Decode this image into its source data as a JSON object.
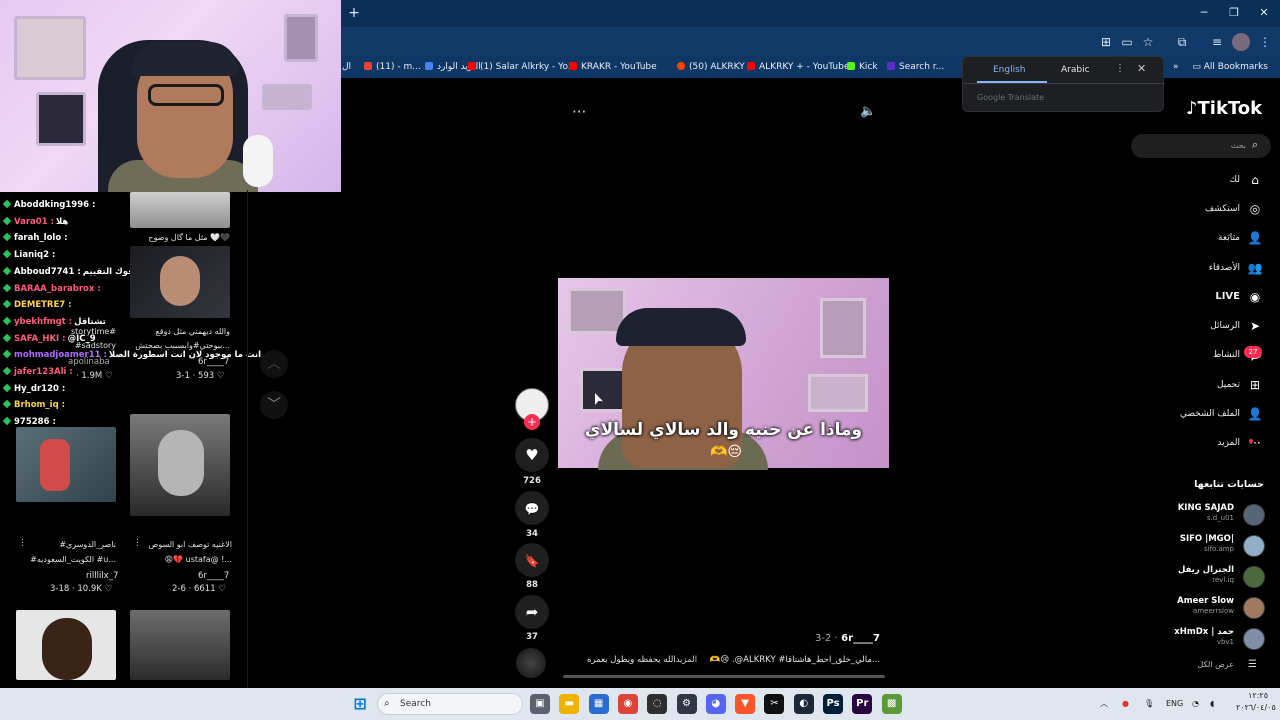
{
  "browser": {
    "new_tab_label": "+",
    "window_controls": {
      "minimize": "─",
      "restore": "❐",
      "close": "✕"
    },
    "bookmarks": [
      {
        "label": "ال",
        "color": "#888888"
      },
      {
        "label": "(11) - m...",
        "color": "#ea4335"
      },
      {
        "label": "البريد الوارد",
        "color": "#4285f4"
      },
      {
        "label": "(1) Salar Alkrky - Yo...",
        "color": "#ff0000"
      },
      {
        "label": "KRAKR - YouTube",
        "color": "#ff0000"
      },
      {
        "label": "(50) ALKRKY",
        "color": "#ff4500"
      },
      {
        "label": "ALKRKY + - YouTube",
        "color": "#ff0000"
      },
      {
        "label": "Kick",
        "color": "#53fc18"
      },
      {
        "label": "Search r...",
        "color": "#5b2ec7"
      },
      {
        "label": "رافت -",
        "color": "#777777"
      }
    ],
    "all_bookmarks_label": "All Bookmarks",
    "more_bookmarks_label": "»"
  },
  "translate_popup": {
    "tab_english": "English",
    "tab_arabic": "Arabic",
    "more_icon": "⋮",
    "close_icon": "✕",
    "brand": "Google Translate"
  },
  "chat": [
    {
      "user": "Aboddking1996 :",
      "msg": "",
      "color": "#ffffff"
    },
    {
      "user": "Vara01 :",
      "msg": "هلا",
      "color": "#ff5c7a"
    },
    {
      "user": "farah_lolo :",
      "msg": "",
      "color": "#ffffff"
    },
    {
      "user": "Lianiq2 :",
      "msg": "",
      "color": "#ffffff"
    },
    {
      "user": "Abboud7741 :",
      "msg": "انت فوك التقييم",
      "color": "#ffffff"
    },
    {
      "user": "BARAA_barabrox :",
      "msg": "",
      "color": "#ff5c7a"
    },
    {
      "user": "DEMETRE7 :",
      "msg": "",
      "color": "#ffd54a"
    },
    {
      "user": "ybekhfmgt :",
      "msg": "تشتاقل",
      "color": "#ff5c7a"
    },
    {
      "user": "SAFA_HKI :",
      "msg": "@IC_9",
      "color": "#ff5c7a"
    },
    {
      "user": "mohmadjoamer11 :",
      "msg": "انت ما موجود لان انت اسطورة الصلا",
      "color": "#b06bff"
    },
    {
      "user": "jafer123Ali :",
      "msg": "",
      "color": "#ff5c7a"
    },
    {
      "user": "Hy_dr120 :",
      "msg": "",
      "color": "#ffffff"
    },
    {
      "user": "Brhom_iq :",
      "msg": "",
      "color": "#ffd54a"
    },
    {
      "user": "975286 :",
      "msg": "",
      "color": "#ffffff"
    }
  ],
  "gallery": [
    {
      "caption": "مثل ما گال وضوح 🤍🖤",
      "author": "",
      "stats": ""
    },
    {
      "caption": "والله ديهمني مثل دوقع",
      "caption2": "ببوحتي#وابسببب بصحتش...",
      "author": "6r____7",
      "stats": "3-1 · 593 ♡"
    },
    {
      "caption": "storytime#",
      "caption2": "#sadstory",
      "author": "apolinaba",
      "stats": "· 1.9M ♡"
    },
    {
      "caption": "#ناصر_الدوسري",
      "caption2": "#الكويت_السعوديه #u...",
      "author": "rilllilx_7",
      "stats": "3-18 · 10.9K ♡"
    },
    {
      "caption": "الاغنيه توصف ابو السوص",
      "caption2": "😩💔 ustafa@ !...",
      "author": "6r____7",
      "stats": "2-6 · 6611 ♡"
    }
  ],
  "nav_arrows": {
    "up": "︿",
    "down": "﹀"
  },
  "video": {
    "subtitle": "وماذا عن حنيه والد سالاي لسالاي",
    "emoji": "🫶😔",
    "more_icon": "···",
    "mute_icon": "🔈",
    "actions": [
      {
        "icon": "♥",
        "count": "726",
        "name": "like"
      },
      {
        "icon": "💬",
        "count": "34",
        "name": "comment"
      },
      {
        "icon": "🔖",
        "count": "88",
        "name": "save"
      },
      {
        "icon": "➦",
        "count": "37",
        "name": "share"
      }
    ],
    "follow_plus": "+",
    "author": "6r____7",
    "date": "3-2 ·",
    "description": "الله يحفظه ويطول بعمره 🫶😢 .@ALKRKY #مالي_خلق_احط_هاشتاقا...",
    "more_label": "المزيد"
  },
  "tiktok": {
    "logo": "TikTok",
    "search_placeholder": "بحث",
    "nav": [
      {
        "label": "لك",
        "icon": "⌂"
      },
      {
        "label": "استكشف",
        "icon": "◎"
      },
      {
        "label": "متابَعة",
        "icon": "👤"
      },
      {
        "label": "الأصدقاء",
        "icon": "👥"
      },
      {
        "label": "LIVE",
        "icon": "◉"
      },
      {
        "label": "الرسائل",
        "icon": "➤"
      },
      {
        "label": "النشاط",
        "icon": "💬"
      },
      {
        "label": "تحميل",
        "icon": "⊞"
      },
      {
        "label": "الملف الشخصي",
        "icon": "👤"
      },
      {
        "label": "المزيد",
        "icon": "···"
      }
    ],
    "activity_badge": "27",
    "following_title": "حسابات تتابعها",
    "following": [
      {
        "name": "KING SAJAD",
        "handle": "s.d_u01",
        "color": "#556677"
      },
      {
        "name": "SIFO |MGO|",
        "handle": "sifo.amp",
        "color": "#8fb0c8"
      },
      {
        "name": "الجنرال ريفل",
        "handle": "revl.iq",
        "color": "#4b6b3d"
      },
      {
        "name": "Ameer Slow",
        "handle": "ameerrslow",
        "color": "#a07a60"
      },
      {
        "name": "xHmDx | حمد",
        "handle": "vbv1",
        "color": "#7f8fa8"
      }
    ],
    "see_all": "عرض الكل"
  },
  "taskbar": {
    "search_label": "Search",
    "apps": [
      {
        "name": "task-view",
        "color": "#5a6270",
        "glyph": "▣"
      },
      {
        "name": "file-explorer",
        "color": "#f0b400",
        "glyph": "▬"
      },
      {
        "name": "store",
        "color": "#2a6bd1",
        "glyph": "▦"
      },
      {
        "name": "chrome",
        "color": "#db4437",
        "glyph": "◉"
      },
      {
        "name": "obs",
        "color": "#2e2e2e",
        "glyph": "◌"
      },
      {
        "name": "steam-helper",
        "color": "#303846",
        "glyph": "⚙"
      },
      {
        "name": "discord",
        "color": "#5865f2",
        "glyph": "◕"
      },
      {
        "name": "brave",
        "color": "#fb542b",
        "glyph": "▼"
      },
      {
        "name": "capcut",
        "color": "#101010",
        "glyph": "✂"
      },
      {
        "name": "steam",
        "color": "#1b2838",
        "glyph": "◐"
      },
      {
        "name": "photoshop",
        "color": "#001e36",
        "glyph": "Ps"
      },
      {
        "name": "premiere",
        "color": "#2a0640",
        "glyph": "Pr"
      },
      {
        "name": "minecraft",
        "color": "#5a9b38",
        "glyph": "▩"
      }
    ],
    "tray": {
      "chevron": "︿",
      "lang": "ENG",
      "time": "١٢:٢٥",
      "date": "٢٠٢٦/٠٤/٠٥"
    }
  }
}
